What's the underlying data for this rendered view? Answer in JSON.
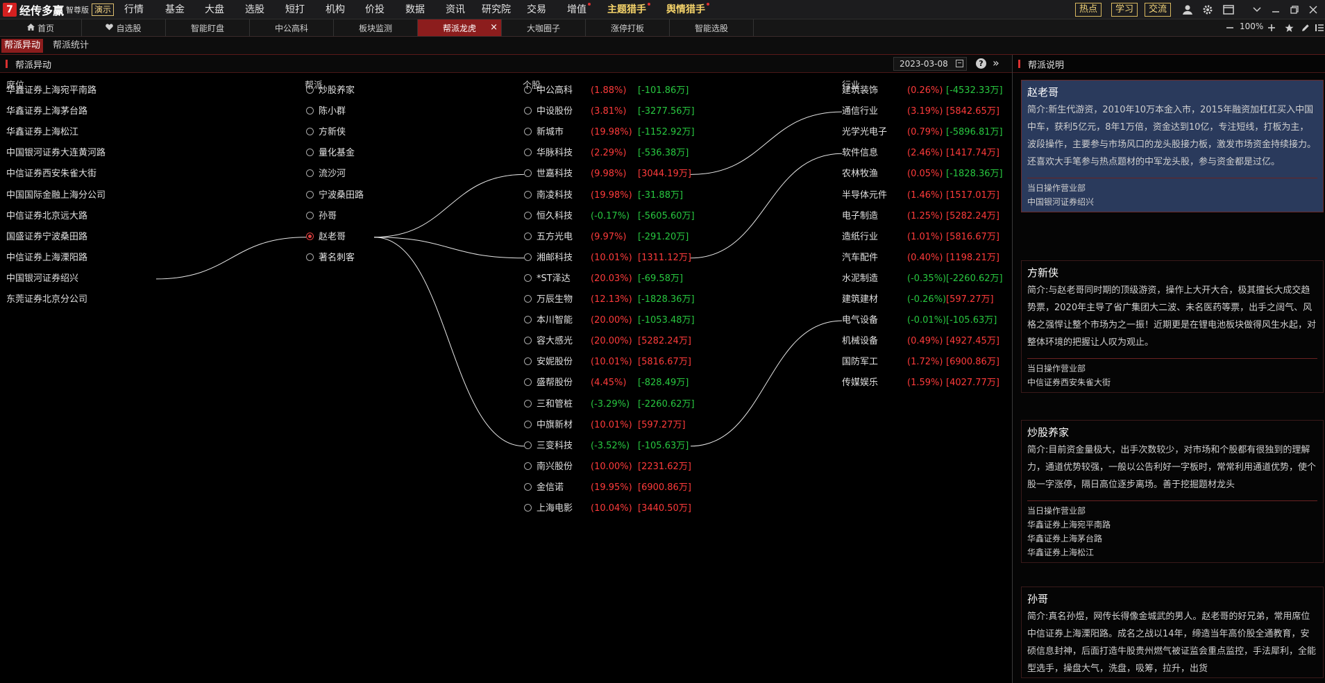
{
  "app": {
    "name": "经传多赢",
    "edition": "智尊版",
    "demo": "演示"
  },
  "menu": [
    {
      "label": "行情"
    },
    {
      "label": "基金"
    },
    {
      "label": "大盘"
    },
    {
      "label": "选股"
    },
    {
      "label": "短打"
    },
    {
      "label": "机构"
    },
    {
      "label": "价投"
    },
    {
      "label": "数据"
    },
    {
      "label": "资讯"
    },
    {
      "label": "研究院"
    },
    {
      "label": "交易"
    },
    {
      "label": "增值"
    },
    {
      "label": "主题猎手"
    },
    {
      "label": "舆情猎手"
    }
  ],
  "header_buttons": [
    "热点",
    "学习",
    "交流"
  ],
  "tabs": [
    "首页",
    "自选股",
    "智能盯盘",
    "中公高科",
    "板块监测",
    "帮派龙虎",
    "大咖圈子",
    "涨停打板",
    "智能选股"
  ],
  "zoom": "100%",
  "subtabs": [
    "帮派异动",
    "帮派统计"
  ],
  "panel": {
    "title": "帮派异动",
    "date": "2023-03-08"
  },
  "columns": {
    "seat": "席位",
    "faction": "帮派",
    "stock": "个股",
    "industry": "行业"
  },
  "seats": [
    "华鑫证券上海宛平南路",
    "华鑫证券上海茅台路",
    "华鑫证券上海松江",
    "中国银河证券大连黄河路",
    "中信证券西安朱雀大街",
    "中国国际金融上海分公司",
    "中信证券北京远大路",
    "国盛证券宁波桑田路",
    "中信证券上海溧阳路",
    "中国银河证券绍兴",
    "东莞证券北京分公司"
  ],
  "factions": [
    "炒股养家",
    "陈小群",
    "方新侠",
    "量化基金",
    "流沙河",
    "宁波桑田路",
    "孙哥",
    "赵老哥",
    "著名刺客"
  ],
  "selected_faction": "赵老哥",
  "stocks": [
    {
      "name": "中公高科",
      "pct": "(1.88%)",
      "amt": "[-101.86万]",
      "pct_dir": "up",
      "amt_dir": "dn"
    },
    {
      "name": "中设股份",
      "pct": "(3.81%)",
      "amt": "[-3277.56万]",
      "pct_dir": "up",
      "amt_dir": "dn"
    },
    {
      "name": "新城市",
      "pct": "(19.98%)",
      "amt": "[-1152.92万]",
      "pct_dir": "up",
      "amt_dir": "dn"
    },
    {
      "name": "华脉科技",
      "pct": "(2.29%)",
      "amt": "[-536.38万]",
      "pct_dir": "up",
      "amt_dir": "dn"
    },
    {
      "name": "世嘉科技",
      "pct": "(9.98%)",
      "amt": "[3044.19万]",
      "pct_dir": "up",
      "amt_dir": "up"
    },
    {
      "name": "南凌科技",
      "pct": "(19.98%)",
      "amt": "[-31.88万]",
      "pct_dir": "up",
      "amt_dir": "dn"
    },
    {
      "name": "恒久科技",
      "pct": "(-0.17%)",
      "amt": "[-5605.60万]",
      "pct_dir": "dn",
      "amt_dir": "dn"
    },
    {
      "name": "五方光电",
      "pct": "(9.97%)",
      "amt": "[-291.20万]",
      "pct_dir": "up",
      "amt_dir": "dn"
    },
    {
      "name": "湘邮科技",
      "pct": "(10.01%)",
      "amt": "[1311.12万]",
      "pct_dir": "up",
      "amt_dir": "up"
    },
    {
      "name": "*ST泽达",
      "pct": "(20.03%)",
      "amt": "[-69.58万]",
      "pct_dir": "up",
      "amt_dir": "dn"
    },
    {
      "name": "万辰生物",
      "pct": "(12.13%)",
      "amt": "[-1828.36万]",
      "pct_dir": "up",
      "amt_dir": "dn"
    },
    {
      "name": "本川智能",
      "pct": "(20.00%)",
      "amt": "[-1053.48万]",
      "pct_dir": "up",
      "amt_dir": "dn"
    },
    {
      "name": "容大感光",
      "pct": "(20.00%)",
      "amt": "[5282.24万]",
      "pct_dir": "up",
      "amt_dir": "up"
    },
    {
      "name": "安妮股份",
      "pct": "(10.01%)",
      "amt": "[5816.67万]",
      "pct_dir": "up",
      "amt_dir": "up"
    },
    {
      "name": "盛帮股份",
      "pct": "(4.45%)",
      "amt": "[-828.49万]",
      "pct_dir": "up",
      "amt_dir": "dn"
    },
    {
      "name": "三和管桩",
      "pct": "(-3.29%)",
      "amt": "[-2260.62万]",
      "pct_dir": "dn",
      "amt_dir": "dn"
    },
    {
      "name": "中旗新材",
      "pct": "(10.01%)",
      "amt": "[597.27万]",
      "pct_dir": "up",
      "amt_dir": "up"
    },
    {
      "name": "三变科技",
      "pct": "(-3.52%)",
      "amt": "[-105.63万]",
      "pct_dir": "dn",
      "amt_dir": "dn"
    },
    {
      "name": "南兴股份",
      "pct": "(10.00%)",
      "amt": "[2231.62万]",
      "pct_dir": "up",
      "amt_dir": "up"
    },
    {
      "name": "金信诺",
      "pct": "(19.95%)",
      "amt": "[6900.86万]",
      "pct_dir": "up",
      "amt_dir": "up"
    },
    {
      "name": "上海电影",
      "pct": "(10.04%)",
      "amt": "[3440.50万]",
      "pct_dir": "up",
      "amt_dir": "up"
    }
  ],
  "industries": [
    {
      "name": "建筑装饰",
      "pct": "(0.26%)",
      "amt": "[-4532.33万]",
      "pct_dir": "up",
      "amt_dir": "dn"
    },
    {
      "name": "通信行业",
      "pct": "(3.19%)",
      "amt": "[5842.65万]",
      "pct_dir": "up",
      "amt_dir": "up"
    },
    {
      "name": "光学光电子",
      "pct": "(0.79%)",
      "amt": "[-5896.81万]",
      "pct_dir": "up",
      "amt_dir": "dn"
    },
    {
      "name": "软件信息",
      "pct": "(2.46%)",
      "amt": "[1417.74万]",
      "pct_dir": "up",
      "amt_dir": "up"
    },
    {
      "name": "农林牧渔",
      "pct": "(0.05%)",
      "amt": "[-1828.36万]",
      "pct_dir": "up",
      "amt_dir": "dn"
    },
    {
      "name": "半导体元件",
      "pct": "(1.46%)",
      "amt": "[1517.01万]",
      "pct_dir": "up",
      "amt_dir": "up"
    },
    {
      "name": "电子制造",
      "pct": "(1.25%)",
      "amt": "[5282.24万]",
      "pct_dir": "up",
      "amt_dir": "up"
    },
    {
      "name": "造纸行业",
      "pct": "(1.01%)",
      "amt": "[5816.67万]",
      "pct_dir": "up",
      "amt_dir": "up"
    },
    {
      "name": "汽车配件",
      "pct": "(0.40%)",
      "amt": "[1198.21万]",
      "pct_dir": "up",
      "amt_dir": "up"
    },
    {
      "name": "水泥制造",
      "pct": "(-0.35%)",
      "amt": "[-2260.62万]",
      "pct_dir": "dn",
      "amt_dir": "dn"
    },
    {
      "name": "建筑建材",
      "pct": "(-0.26%)",
      "amt": "[597.27万]",
      "pct_dir": "dn",
      "amt_dir": "up"
    },
    {
      "name": "电气设备",
      "pct": "(-0.01%)",
      "amt": "[-105.63万]",
      "pct_dir": "dn",
      "amt_dir": "dn"
    },
    {
      "name": "机械设备",
      "pct": "(0.49%)",
      "amt": "[4927.45万]",
      "pct_dir": "up",
      "amt_dir": "up"
    },
    {
      "name": "国防军工",
      "pct": "(1.72%)",
      "amt": "[6900.86万]",
      "pct_dir": "up",
      "amt_dir": "up"
    },
    {
      "name": "传媒娱乐",
      "pct": "(1.59%)",
      "amt": "[4027.77万]",
      "pct_dir": "up",
      "amt_dir": "up"
    }
  ],
  "links": {
    "seat_to_faction": [
      {
        "seat": 9,
        "faction": 7
      }
    ],
    "faction_to_stock": [
      {
        "faction": 7,
        "stock": 4
      },
      {
        "faction": 7,
        "stock": 8
      },
      {
        "faction": 7,
        "stock": 17
      }
    ],
    "stock_to_industry": [
      {
        "stock": 4,
        "industry": 1
      },
      {
        "stock": 8,
        "industry": 3
      },
      {
        "stock": 17,
        "industry": 11
      }
    ]
  },
  "right_panel": {
    "title": "帮派说明",
    "dept_label": "当日操作营业部",
    "cards": [
      {
        "name": "赵老哥",
        "intro": "简介:新生代游资，2010年10万本金入市，2015年融资加杠杠买入中国中车，获利5亿元，8年1万倍，资金达到10亿，专注短线，打板为主，波段操作，主要参与市场风口的龙头股接力板，激发市场资金持续接力。还喜欢大手笔参与热点题材的中军龙头股，参与资金都是过亿。",
        "depts": [
          "中国银河证券绍兴"
        ]
      },
      {
        "name": "方新侠",
        "intro": "简介:与赵老哥同时期的顶级游资，操作上大开大合，极其擅长大成交趋势票，2020年主导了省广集团大二波、未名医药等票，出手之阔气、风格之强悍让整个市场为之一振！近期更是在锂电池板块做得风生水起，对整体环境的把握让人叹为观止。",
        "depts": [
          "中信证券西安朱雀大街"
        ]
      },
      {
        "name": "炒股养家",
        "intro": "简介:目前资金量极大，出手次数较少，对市场和个股都有很独到的理解力，通道优势较强，一般以公告利好一字板时，常常利用通道优势，使个股一字涨停，隔日高位逐步离场。善于挖掘题材龙头",
        "depts": [
          "华鑫证券上海宛平南路",
          "华鑫证券上海茅台路",
          "华鑫证券上海松江"
        ]
      },
      {
        "name": "孙哥",
        "intro": "简介:真名孙煜，网传长得像金城武的男人。赵老哥的好兄弟，常用席位中信证券上海溧阳路。成名之战以14年，缔造当年高价股全通教育，安硕信息封神，后面打造牛股贵州燃气被证监会重点监控，手法犀利，全能型选手，操盘大气，洗盘，吸筹，拉升，出货",
        "depts": []
      }
    ]
  },
  "colors": {
    "up": "#ff3b3b",
    "down": "#28c840",
    "accent": "#8c1d1d",
    "selected_card": "#2a3a5c"
  }
}
